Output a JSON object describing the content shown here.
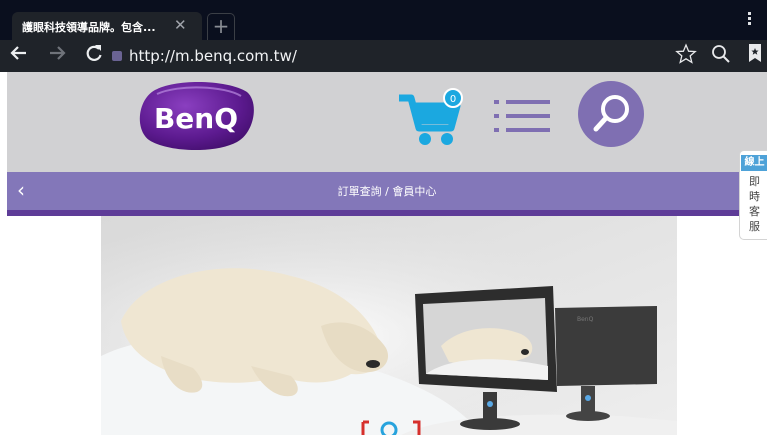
{
  "browser": {
    "tab_title": "護眼科技領導品牌。包含...",
    "tab_close": "✕",
    "new_tab": "+",
    "url": "http://m.benq.com.tw/",
    "icons": [
      "back-arrow-icon",
      "forward-arrow-icon",
      "reload-icon",
      "site-favicon",
      "star-icon",
      "search-icon",
      "bookmark-icon",
      "overflow-menu-icon"
    ]
  },
  "header": {
    "logo_text": "BenQ",
    "cart_count": "0",
    "colors": {
      "header_bg": "#d1d1d3",
      "cart": "#1ba8e0",
      "brand_purple": "#5e1f8f",
      "search_circle": "#7f6fb2"
    }
  },
  "nav": {
    "back": "‹",
    "title": "訂單查詢 / 會員中心",
    "colors": {
      "bar": "#8377b9",
      "underline": "#5e3c98"
    }
  },
  "chat": {
    "head": "線上",
    "chars": [
      "即",
      "時",
      "客",
      "服"
    ]
  },
  "banner": {
    "brand_on_monitor": "BenQ"
  }
}
